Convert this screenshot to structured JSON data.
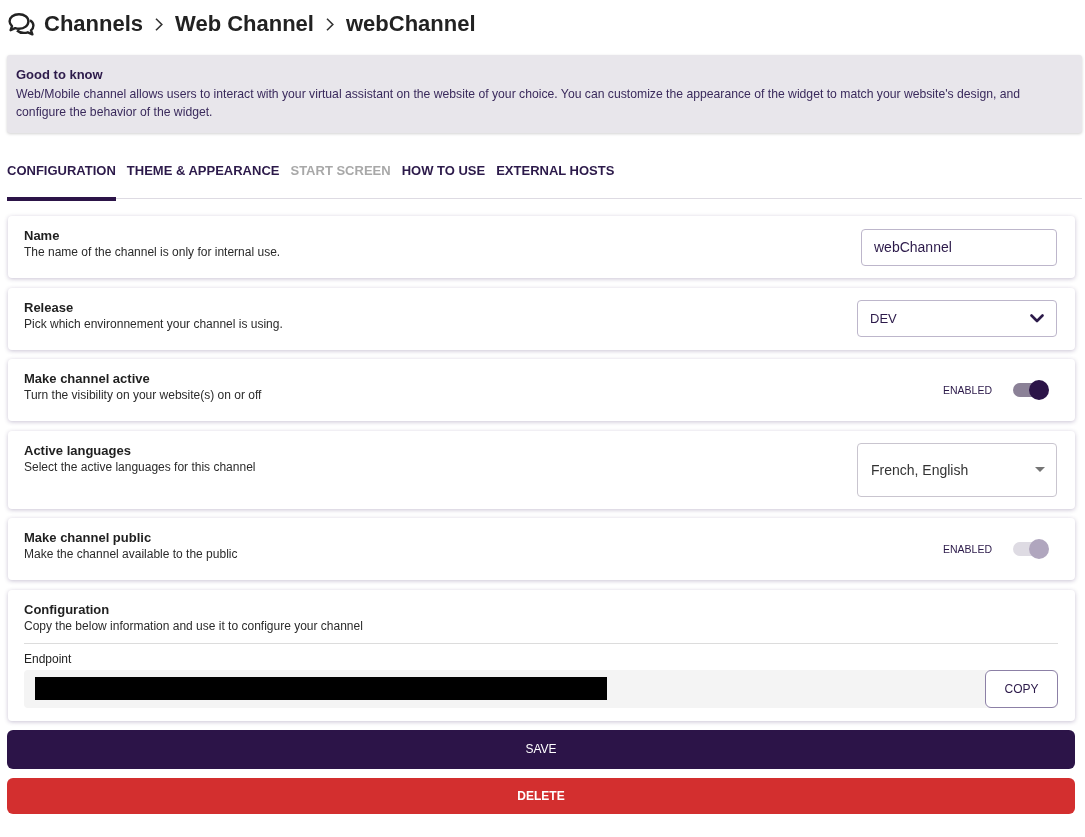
{
  "header": {
    "breadcrumb": [
      "Channels",
      "Web Channel",
      "webChannel"
    ]
  },
  "info": {
    "title": "Good to know",
    "text": "Web/Mobile channel allows users to interact with your virtual assistant on the website of your choice. You can customize the appearance of the widget to match your website's design, and configure the behavior of the widget."
  },
  "tabs": [
    {
      "label": "CONFIGURATION",
      "selected": true,
      "disabled": false
    },
    {
      "label": "THEME & APPEARANCE",
      "selected": false,
      "disabled": false
    },
    {
      "label": "START SCREEN",
      "selected": false,
      "disabled": true
    },
    {
      "label": "HOW TO USE",
      "selected": false,
      "disabled": false
    },
    {
      "label": "EXTERNAL HOSTS",
      "selected": false,
      "disabled": false
    }
  ],
  "settings": [
    {
      "kind": "text",
      "title": "Name",
      "description": "The name of the channel is only for internal use.",
      "value": "webChannel"
    },
    {
      "kind": "dropdown",
      "title": "Release",
      "description": "Pick which environnement your channel is using.",
      "value": "DEV"
    },
    {
      "kind": "toggle",
      "title": "Make channel active",
      "description": "Turn the visibility on your website(s) on or off",
      "state_label": "ENABLED",
      "on": true,
      "disabled": false
    },
    {
      "kind": "multiselect",
      "title": "Active languages",
      "description": "Select the active languages for this channel",
      "value": "French, English"
    },
    {
      "kind": "toggle",
      "title": "Make channel public",
      "description": "Make the channel available to the public",
      "state_label": "ENABLED",
      "on": true,
      "disabled": true
    }
  ],
  "configuration": {
    "title": "Configuration",
    "description": "Copy the below information and use it to configure your channel",
    "endpoint": {
      "label": "Endpoint",
      "redacted": true,
      "copy_button": "COPY"
    }
  },
  "actions": [
    {
      "kind": "primary",
      "label": "SAVE"
    },
    {
      "kind": "danger",
      "label": "DELETE"
    }
  ]
}
